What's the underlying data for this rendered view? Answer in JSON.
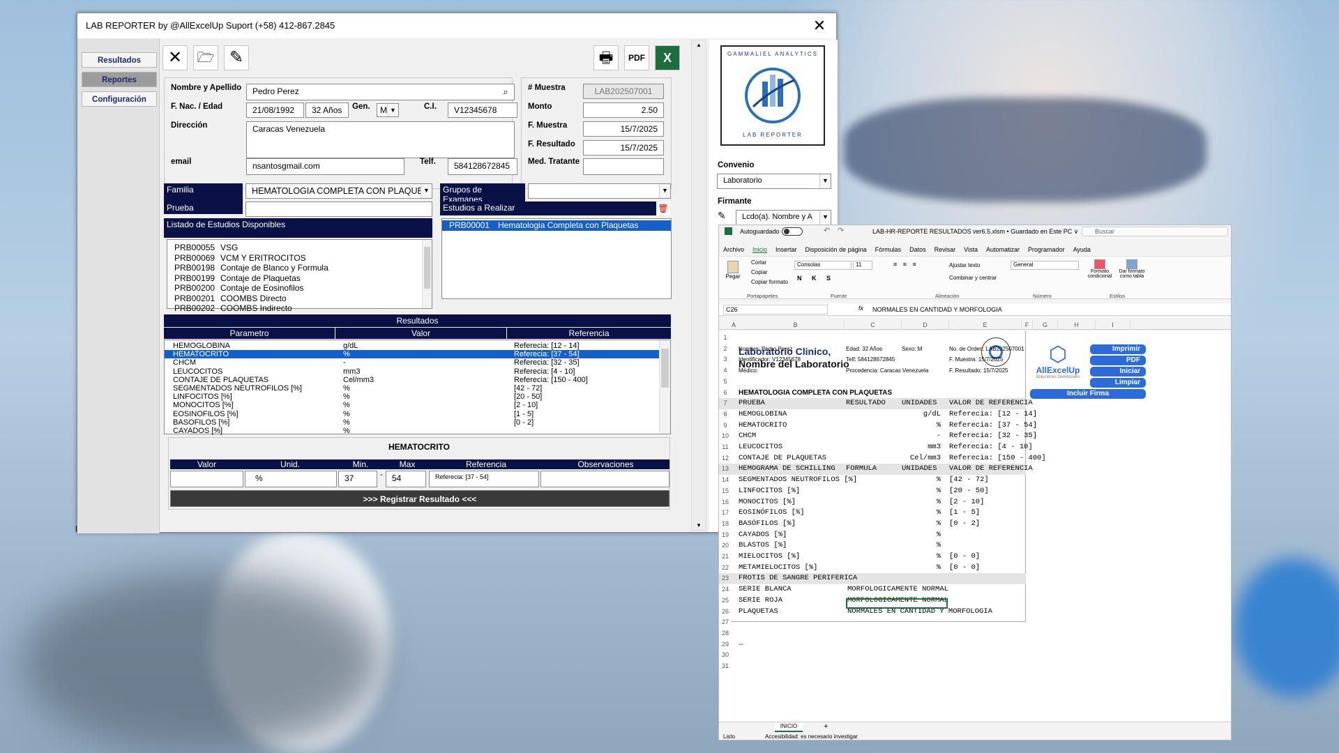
{
  "window": {
    "title": "LAB REPORTER by @AllExcelUp Suport (+58) 412-867.2845",
    "close": "✕"
  },
  "sidebar": {
    "items": [
      "Resultados",
      "Reportes",
      "Configuración"
    ]
  },
  "toolbar": {
    "cancel": "✕",
    "folder": "🗁",
    "edit": "✎",
    "print": "🖶",
    "pdf": "PDF",
    "excel": "X"
  },
  "patient": {
    "name_label": "Nombre y Apellido",
    "name": "Pedro Perez",
    "dob_label": "F. Nac. / Edad",
    "dob": "21/08/1992",
    "age": "32 Años",
    "gen_label": "Gen.",
    "gen": "M",
    "ci_label": "C.I.",
    "ci": "V12345678",
    "address_label": "Dirección",
    "address": "Caracas Venezuela",
    "email_label": "email",
    "email": "nsantosgmail.com",
    "phone_label": "Telf.",
    "phone": "584128672845"
  },
  "sample": {
    "num_label": "# Muestra",
    "num": "LAB202507001",
    "monto_label": "Monto",
    "monto": "2.50",
    "fmuestra_label": "F. Muestra",
    "fmuestra": "15/7/2025",
    "fresultado_label": "F. Resultado",
    "fresultado": "15/7/2025",
    "medico_label": "Med. Tratante",
    "medico": ""
  },
  "logo": {
    "top": "GAMMALIEL ANALYTICS",
    "bottom": "LAB REPORTER"
  },
  "convenio": {
    "label": "Convenio",
    "value": "Laboratorio"
  },
  "firmante": {
    "label": "Firmante",
    "value": "Lcdo(a). Nombre y A"
  },
  "study": {
    "familia_label": "Familia",
    "familia": "HEMATOLOGIA COMPLETA CON PLAQUETAS",
    "grupos_label": "Grupos de Examanes",
    "grupos": "",
    "prueba_label": "Prueba",
    "prueba": "",
    "estudios_label": "Estudios a Realizar",
    "listado_label": "Listado de Estudios Disponibles",
    "available": [
      {
        "code": "PRB00055",
        "name": "VSG"
      },
      {
        "code": "PRB00069",
        "name": "VCM Y ERITROCITOS"
      },
      {
        "code": "PRB00198",
        "name": "Contaje de Blanco y Formula"
      },
      {
        "code": "PRB00199",
        "name": "Contaje de Plaquetas"
      },
      {
        "code": "PRB00200",
        "name": "Contaje de Eosinofilos"
      },
      {
        "code": "PRB00201",
        "name": "COOMBS Directo"
      },
      {
        "code": "PRB00202",
        "name": "COOMBS Indirecto"
      }
    ],
    "selected": [
      {
        "code": "PRB00001",
        "name": "Hematologia Completa con Plaquetas"
      }
    ]
  },
  "results": {
    "title": "Resultados",
    "headers": [
      "Parametro",
      "Valor",
      "Referencia"
    ],
    "rows": [
      {
        "p": "HEMOGLOBINA",
        "v": "g/dL",
        "r": "Referecia: [12 - 14]"
      },
      {
        "p": "HEMATOCRITO",
        "v": "%",
        "r": "Referecia: [37 - 54]",
        "sel": true
      },
      {
        "p": "CHCM",
        "v": "-",
        "r": "Referecia: [32 - 35]"
      },
      {
        "p": "LEUCOCITOS",
        "v": "mm3",
        "r": "Referecia: [4 - 10]"
      },
      {
        "p": "CONTAJE DE PLAQUETAS",
        "v": "Cel/mm3",
        "r": "Referecia: [150 - 400]"
      },
      {
        "p": "SEGMENTADOS NEUTROFILOS [%]",
        "v": "%",
        "r": "[42 - 72]"
      },
      {
        "p": "LINFOCITOS [%]",
        "v": "%",
        "r": "[20 - 50]"
      },
      {
        "p": "MONOCITOS [%]",
        "v": "%",
        "r": "[2 - 10]"
      },
      {
        "p": "EOSINOFILOS [%]",
        "v": "%",
        "r": "[1 - 5]"
      },
      {
        "p": "BASOFILOS [%]",
        "v": "%",
        "r": "[0 - 2]"
      },
      {
        "p": "CAYADOS [%]",
        "v": "%",
        "r": ""
      }
    ]
  },
  "entry": {
    "title": "HEMATOCRITO",
    "headers": [
      "Valor",
      "Unid.",
      "Min.",
      "Max",
      "Referencia",
      "Observaciones"
    ],
    "valor": "",
    "unid": "%",
    "min": "37",
    "dash": "-",
    "max": "54",
    "ref": "Referecia: [37 - 54]",
    "obs": "",
    "register": ">>> Registrar Resultado <<<"
  },
  "behind_text": "MENTE  NORMAL",
  "excel": {
    "autosave": "Autoguardado",
    "filename": "LAB-HR-REPORTE RESULTADOS ver6.5.xlsm  •  Guardado en Este PC ∨",
    "search": "Buscar",
    "menu": [
      "Archivo",
      "Inicio",
      "Insertar",
      "Disposición de página",
      "Fórmulas",
      "Datos",
      "Revisar",
      "Vista",
      "Automatizar",
      "Programador",
      "Ayuda"
    ],
    "ribbon": {
      "paste": "Pegar",
      "cut": "Cortar",
      "copy": "Copiar",
      "format_copy": "Copiar formato",
      "font": "Consolas",
      "size": "11",
      "wrap": "Ajustar texto",
      "merge": "Combinar y centrar",
      "numfmt": "General",
      "cond": "Formato condicional",
      "table": "Dar formato como tabla",
      "groups": [
        "Portapapeles",
        "Fuente",
        "Alineación",
        "Número",
        "Estilos"
      ]
    },
    "namebox": "C26",
    "fx": "fx",
    "formula": "NORMALES EN CANTIDAD Y MORFOLOGIA",
    "cols": [
      "A",
      "B",
      "C",
      "D",
      "E",
      "F",
      "G",
      "H",
      "I"
    ],
    "lab_name1": "Laboratorio Clinico,",
    "lab_name2": "Nombre del Laboratorio",
    "info": {
      "nombre": "Nombre: Pedro Perez",
      "edad": "Edad: 32 Años",
      "sexo": "Sexo: M",
      "orden": "No. de Orden: LAB202507001",
      "ident": "Identificador: V12345678",
      "telf": "Telf: 584128672845",
      "fmuestra": "F. Muestra: 15/7/2025",
      "medico": "Médico:",
      "proc": "Procedencia: Caracas Venezuela",
      "fres": "F. Resultado: 15/7/2025"
    },
    "section_title": "HEMATOLOGIA COMPLETA CON PLAQUETAS",
    "head1": [
      "PRUEBA",
      "RESULTADO",
      "UNIDADES",
      "VALOR DE REFERENCIA"
    ],
    "rows1": [
      [
        "HEMOGLOBINA",
        "",
        "g/dL",
        "Referecia: [12 - 14]"
      ],
      [
        "HEMATOCRITO",
        "",
        "%",
        "Referecia: [37 - 54]"
      ],
      [
        "CHCM",
        "",
        "-",
        "Referecia: [32 - 35]"
      ],
      [
        "LEUCOCITOS",
        "",
        "mm3",
        "Referecia: [4 - 10]"
      ],
      [
        "CONTAJE DE PLAQUETAS",
        "",
        "Cel/mm3",
        "Referecia: [150 - 400]"
      ]
    ],
    "head2": [
      "HEMOGRAMA DE SCHILLING",
      "FORMULA",
      "UNIDADES",
      "VALOR DE REFERENCIA"
    ],
    "rows2": [
      [
        "SEGMENTADOS NEUTROFILOS [%]",
        "",
        "%",
        "[42 - 72]"
      ],
      [
        "LINFOCITOS [%]",
        "",
        "%",
        "[20 - 50]"
      ],
      [
        "MONOCITOS [%]",
        "",
        "%",
        "[2 - 10]"
      ],
      [
        "EOSINÓFILOS [%]",
        "",
        "%",
        "[1 - 5]"
      ],
      [
        "BASÓFILOS [%]",
        "",
        "%",
        "[0 - 2]"
      ],
      [
        "CAYADOS [%]",
        "",
        "%",
        ""
      ],
      [
        "BLASTOS [%]",
        "",
        "%",
        ""
      ],
      [
        "MIELOCITOS [%]",
        "",
        "%",
        "[0 - 0]"
      ],
      [
        "METAMIELOCITOS [%]",
        "",
        "%",
        "[0 - 0]"
      ]
    ],
    "head3": "FROTIS DE SANGRE PERIFERICA",
    "rows3": [
      [
        "SERIE BLANCA",
        "MORFOLOGICAMENTE NORMAL"
      ],
      [
        "SERIE ROJA",
        "MORFOLOGICAMENTE NORMAL"
      ],
      [
        "PLAQUETAS",
        "NORMALES EN CANTIDAD Y MORFOLOGIA"
      ]
    ],
    "row29": "--",
    "side_buttons": [
      "Imprimir",
      "PDF",
      "Iniciar",
      "Limpiar",
      "Incluir Firma"
    ],
    "brand": "AllExcelUp",
    "brand_sub": "Soluciones Gerenciales",
    "sheet_tab": "INICIO",
    "add_sheet": "+",
    "status": "Listo",
    "accessibility": "Accesibilidad: es necesario investigar"
  }
}
